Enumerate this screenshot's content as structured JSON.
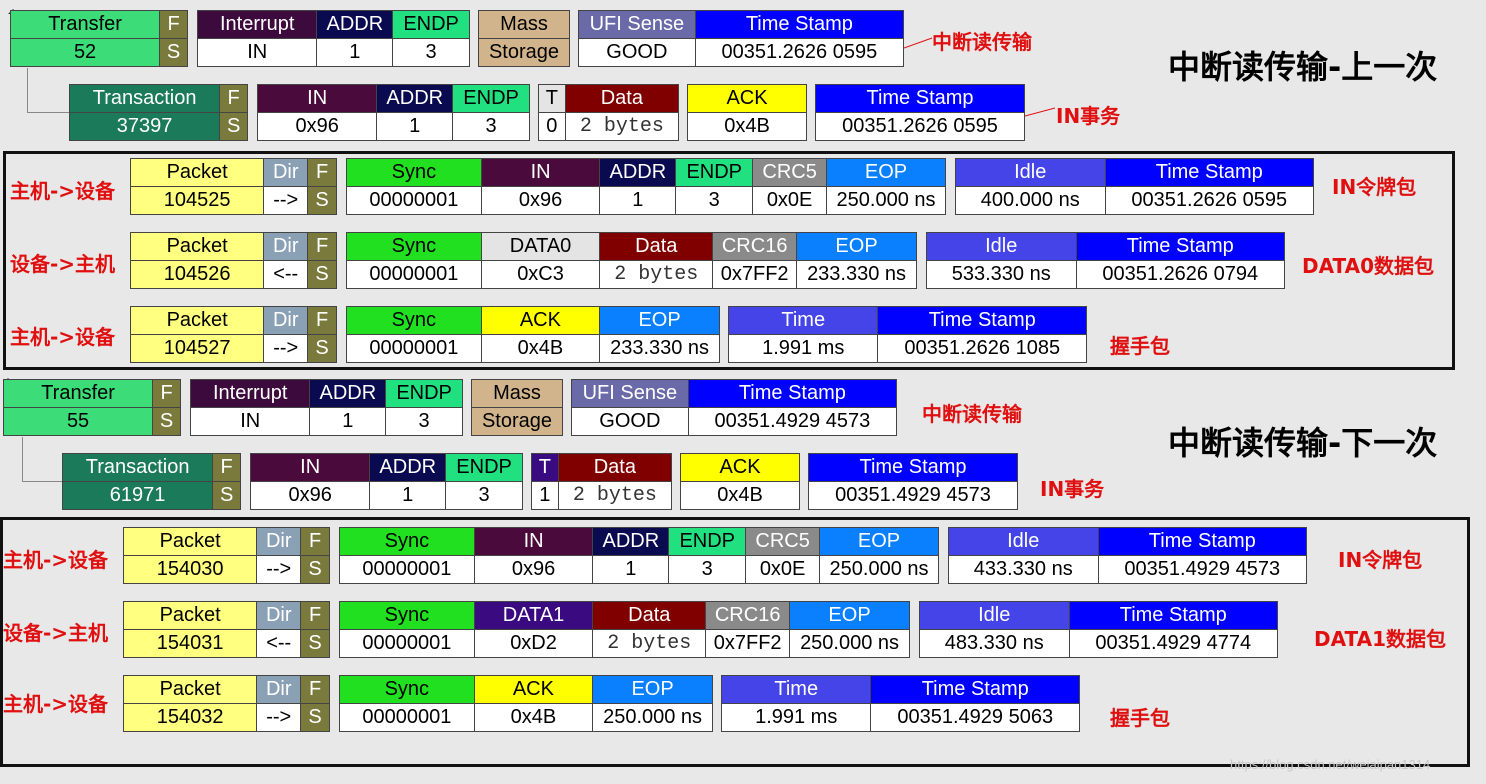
{
  "colors": {
    "transfer": "#3cdc78",
    "transaction": "#1a7a5a",
    "interrupt": "#3d0a3d",
    "addr": "#0a0a50",
    "endp": "#20e080",
    "mass": "#d2b48c",
    "ufi": "#6a6aa8",
    "timestamp": "#0000ff",
    "fs": "#7a7a3c",
    "packet": "#ffff80",
    "dir": "#8aa0b4",
    "sync": "#20e020",
    "in": "#4a0a3c",
    "crc": "#8a8a8a",
    "eop": "#0a80ff",
    "idle": "#4444e8",
    "data": "#800000",
    "data0": "#e4e4e4",
    "data1": "#3a0a80",
    "ack": "#ffff00",
    "annotation": "#e01010"
  },
  "labels": {
    "transfer": "Transfer",
    "transaction": "Transaction",
    "f": "F",
    "s": "S",
    "interrupt": "Interrupt",
    "addr": "ADDR",
    "endp": "ENDP",
    "mass1": "Mass",
    "mass2": "Storage",
    "ufi": "UFI Sense",
    "timestamp": "Time Stamp",
    "in": "IN",
    "t": "T",
    "data": "Data",
    "ack": "ACK",
    "packet": "Packet",
    "dir": "Dir",
    "sync": "Sync",
    "crc5": "CRC5",
    "crc16": "CRC16",
    "eop": "EOP",
    "idle": "Idle",
    "time": "Time",
    "data0": "DATA0",
    "data1": "DATA1"
  },
  "annotations": {
    "interrupt_transfer": "中断读传输",
    "in_transaction": "IN事务",
    "in_token": "IN令牌包",
    "data0_packet": "DATA0数据包",
    "data1_packet": "DATA1数据包",
    "handshake": "握手包",
    "host_to_device": "主机->设备",
    "device_to_host": "设备->主机",
    "prev_title": "中断读传输-上一次",
    "next_title": "中断读传输-下一次"
  },
  "watermark": "https://blog.csdn.net/weiaipan1314",
  "top": {
    "transfer": {
      "num": "52",
      "interrupt": "IN",
      "addr": "1",
      "endp": "3",
      "ufi": "GOOD",
      "ts": "00351.2626 0595"
    },
    "transaction": {
      "num": "37397",
      "in": "0x96",
      "addr": "1",
      "endp": "3",
      "t": "0",
      "data": "2 bytes",
      "ack": "0x4B",
      "ts": "00351.2626 0595"
    },
    "token": {
      "num": "104525",
      "dir": "-->",
      "sync": "00000001",
      "in": "0x96",
      "addr": "1",
      "endp": "3",
      "crc": "0x0E",
      "eop": "250.000 ns",
      "idle": "400.000 ns",
      "ts": "00351.2626 0595"
    },
    "data": {
      "num": "104526",
      "dir": "<--",
      "sync": "00000001",
      "pid": "0xC3",
      "data": "2 bytes",
      "crc": "0x7FF2",
      "eop": "233.330 ns",
      "idle": "533.330 ns",
      "ts": "00351.2626 0794"
    },
    "hs": {
      "num": "104527",
      "dir": "-->",
      "sync": "00000001",
      "ack": "0x4B",
      "eop": "233.330 ns",
      "time": "1.991 ms",
      "ts": "00351.2626 1085"
    }
  },
  "bottom": {
    "transfer": {
      "num": "55",
      "interrupt": "IN",
      "addr": "1",
      "endp": "3",
      "ufi": "GOOD",
      "ts": "00351.4929 4573"
    },
    "transaction": {
      "num": "61971",
      "in": "0x96",
      "addr": "1",
      "endp": "3",
      "t": "1",
      "data": "2 bytes",
      "ack": "0x4B",
      "ts": "00351.4929 4573"
    },
    "token": {
      "num": "154030",
      "dir": "-->",
      "sync": "00000001",
      "in": "0x96",
      "addr": "1",
      "endp": "3",
      "crc": "0x0E",
      "eop": "250.000 ns",
      "idle": "433.330 ns",
      "ts": "00351.4929 4573"
    },
    "data": {
      "num": "154031",
      "dir": "<--",
      "sync": "00000001",
      "pid": "0xD2",
      "data": "2 bytes",
      "crc": "0x7FF2",
      "eop": "250.000 ns",
      "idle": "483.330 ns",
      "ts": "00351.4929 4774"
    },
    "hs": {
      "num": "154032",
      "dir": "-->",
      "sync": "00000001",
      "ack": "0x4B",
      "eop": "250.000 ns",
      "time": "1.991 ms",
      "ts": "00351.4929 5063"
    }
  }
}
